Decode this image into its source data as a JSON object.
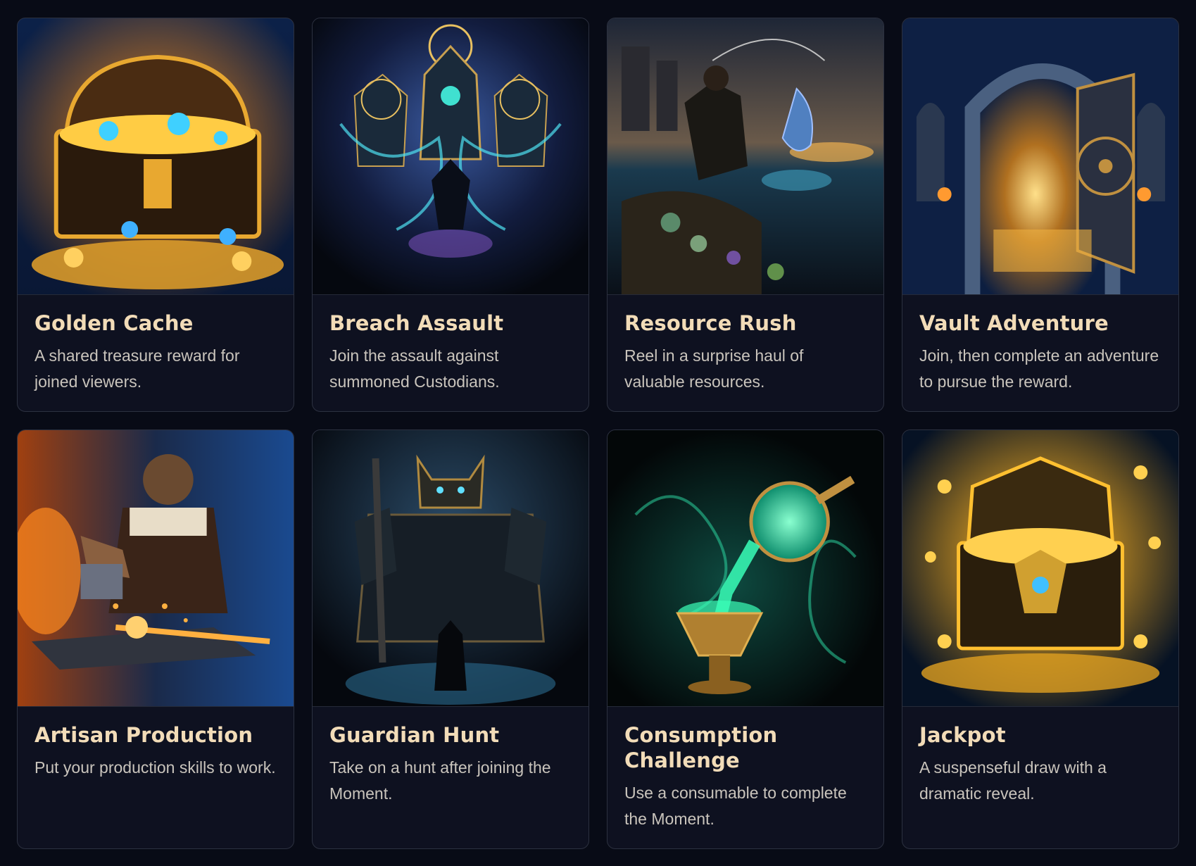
{
  "cards": [
    {
      "title": "Golden Cache",
      "description": "A shared treasure reward for joined viewers.",
      "image": "treasure-chest-image",
      "palette": [
        "#1a3d7a",
        "#f2a324"
      ]
    },
    {
      "title": "Breach Assault",
      "description": "Join the assault against summoned Custodians.",
      "image": "custodians-battle-image",
      "palette": [
        "#0f1c3d",
        "#4ec3e0"
      ]
    },
    {
      "title": "Resource Rush",
      "description": "Reel in a surprise haul of valuable resources.",
      "image": "fishing-haul-image",
      "palette": [
        "#2a3344",
        "#e0a040"
      ]
    },
    {
      "title": "Vault Adventure",
      "description": "Join, then complete an adventure to pursue the reward.",
      "image": "vault-door-image",
      "palette": [
        "#14305e",
        "#f0b040"
      ]
    },
    {
      "title": "Artisan Production",
      "description": "Put your production skills to work.",
      "image": "blacksmith-anvil-image",
      "palette": [
        "#173566",
        "#ff8a20"
      ]
    },
    {
      "title": "Guardian Hunt",
      "description": "Take on a hunt after joining the Moment.",
      "image": "guardian-golem-image",
      "palette": [
        "#0e1a2c",
        "#4fb8d0"
      ]
    },
    {
      "title": "Consumption Challenge",
      "description": "Use a consumable to complete the Moment.",
      "image": "potion-pour-image",
      "palette": [
        "#061012",
        "#2de0a8"
      ]
    },
    {
      "title": "Jackpot",
      "description": "A suspenseful draw with a dramatic reveal.",
      "image": "jackpot-chest-image",
      "palette": [
        "#0a1a30",
        "#ffc030"
      ]
    }
  ]
}
